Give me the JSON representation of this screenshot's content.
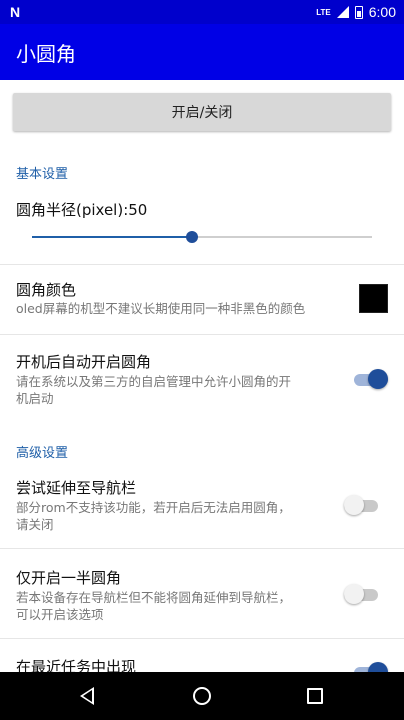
{
  "status_bar": {
    "logo": "N",
    "network": "LTE",
    "time": "6:00"
  },
  "app_bar": {
    "title": "小圆角"
  },
  "toggle_button": {
    "label": "开启/关闭"
  },
  "basic_settings": {
    "header": "基本设置",
    "radius": {
      "label": "圆角半径(pixel):50",
      "slider_fraction": 0.47
    },
    "color": {
      "title": "圆角颜色",
      "description": "oled屏幕的机型不建议长期使用同一种非黑色的颜色",
      "swatch_color": "#000000"
    },
    "autostart": {
      "title": "开机后自动开启圆角",
      "description_line1": "请在系统以及第三方的自启管理中允许小圆角的开",
      "description_line2": "机启动",
      "enabled": true
    }
  },
  "advanced_settings": {
    "header": "高级设置",
    "extend_navbar": {
      "title": "尝试延伸至导航栏",
      "description_line1": "部分rom不支持该功能，若开启后无法启用圆角，",
      "description_line2": "请关闭",
      "enabled": false
    },
    "half_corner": {
      "title": "仅开启一半圆角",
      "description_line1": "若本设备存在导航栏但不能将圆角延伸到导航栏，",
      "description_line2": "可以开启该选项",
      "enabled": false
    },
    "recent_tasks": {
      "title": "在最近任务中出现",
      "enabled": true
    }
  },
  "colors": {
    "primary": "#0000e6",
    "status_bar": "#0000cc",
    "accent": "#1f4e9a",
    "section_header": "#1f5fa8"
  },
  "nav_bar": {
    "icons": [
      "back-icon",
      "home-icon",
      "recents-icon"
    ]
  }
}
